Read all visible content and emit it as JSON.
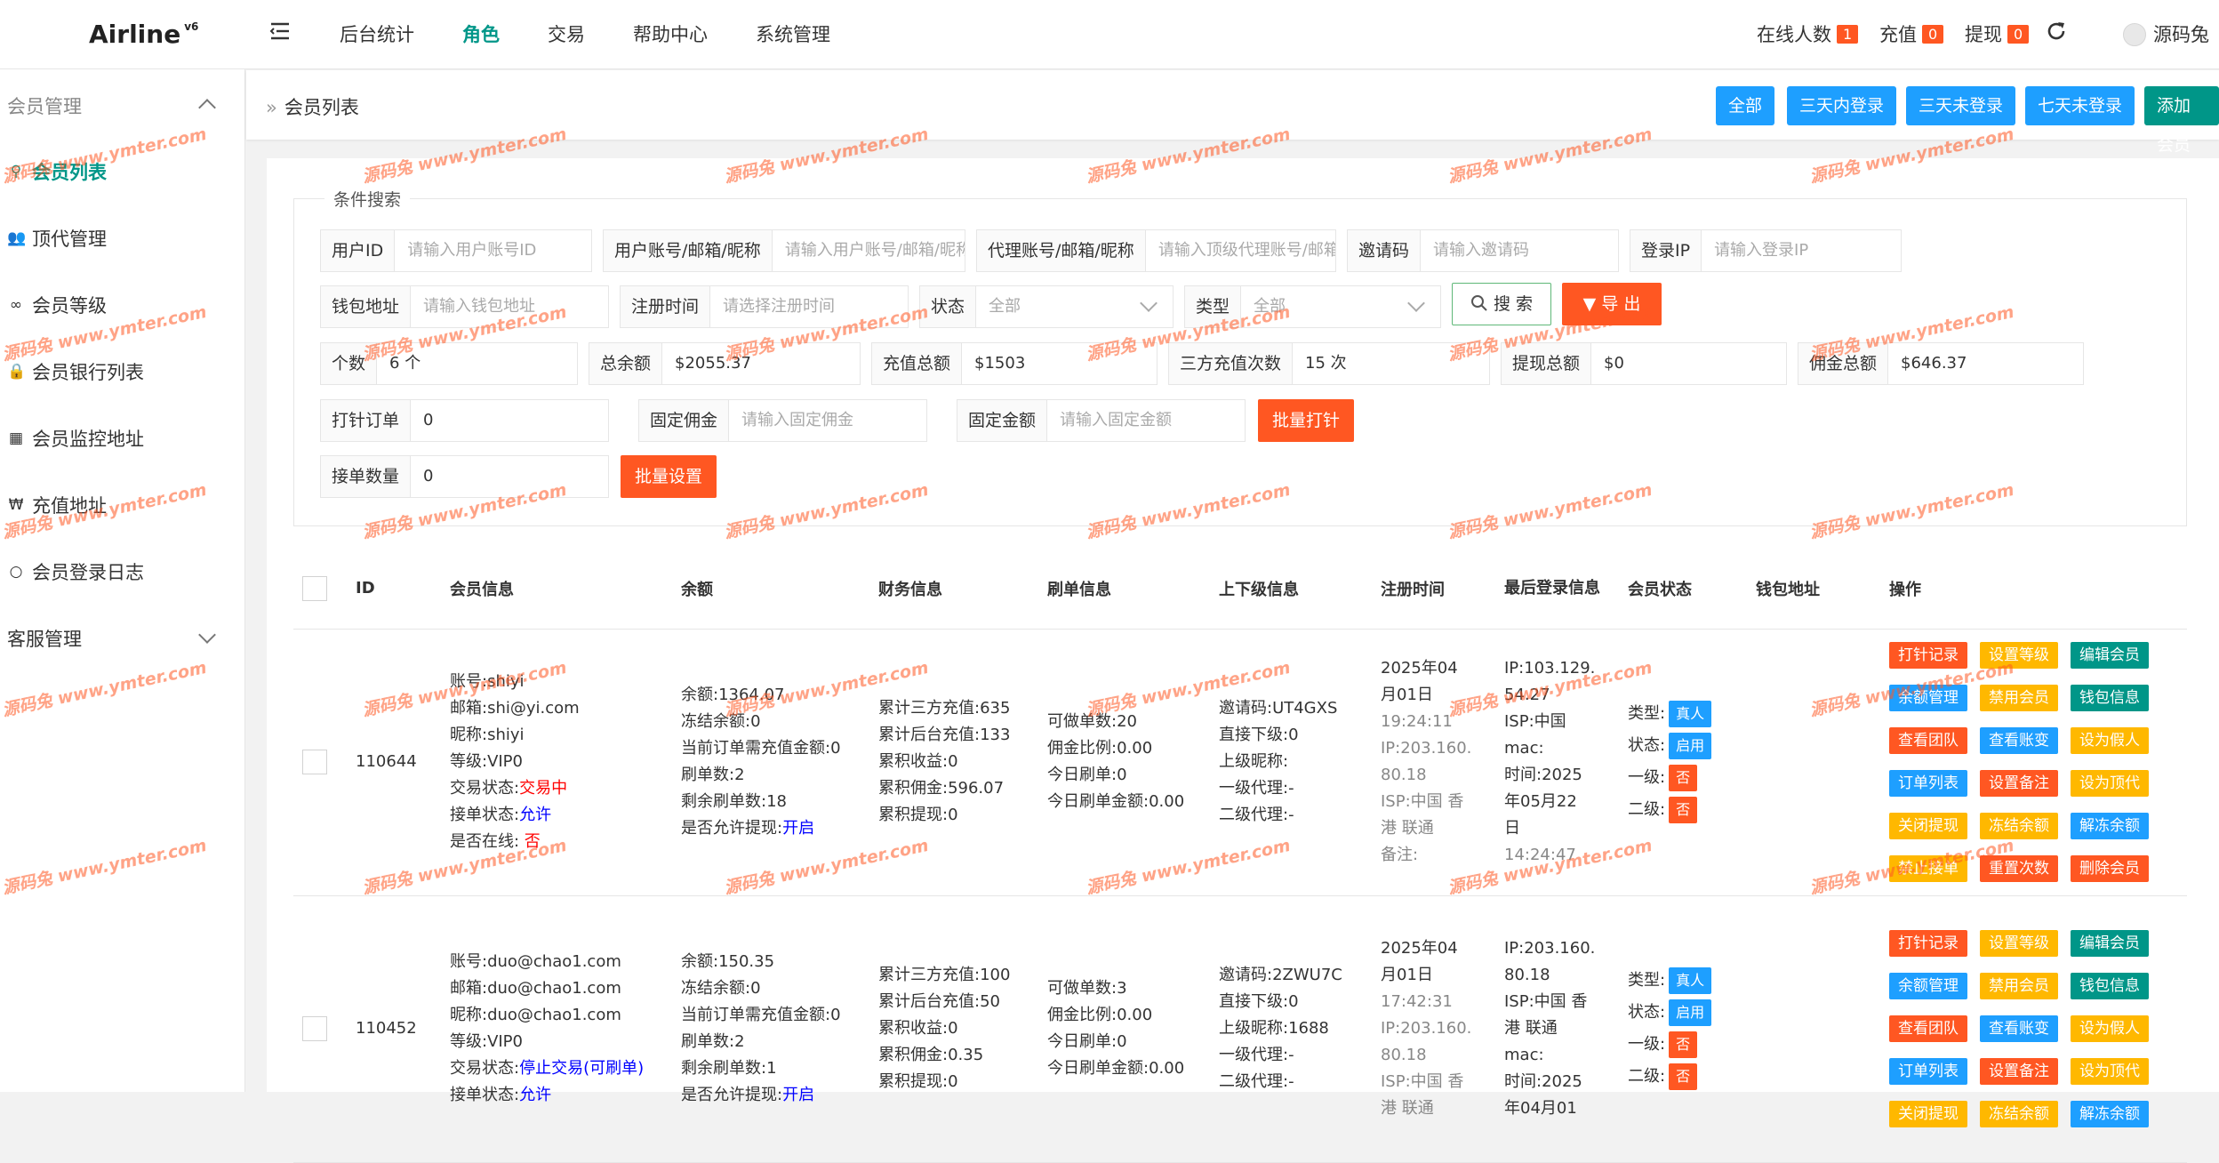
{
  "app": {
    "logo": "Airline",
    "version": "v6"
  },
  "nav": [
    {
      "label": "后台统计"
    },
    {
      "label": "角色"
    },
    {
      "label": "交易"
    },
    {
      "label": "帮助中心"
    },
    {
      "label": "系统管理"
    }
  ],
  "header_stats": {
    "online_label": "在线人数",
    "online_value": "1",
    "recharge_label": "充值",
    "recharge_value": "0",
    "withdraw_label": "提现",
    "withdraw_value": "0",
    "username": "源码兔"
  },
  "sidebar": {
    "group1": "会员管理",
    "items": [
      {
        "label": "会员列表",
        "icon": "user-icon"
      },
      {
        "label": "顶代管理",
        "icon": "users-icon"
      },
      {
        "label": "会员等级",
        "icon": "link-icon"
      },
      {
        "label": "会员银行列表",
        "icon": "lock-icon"
      },
      {
        "label": "会员监控地址",
        "icon": "id-card-icon"
      },
      {
        "label": "充值地址",
        "icon": "won-icon"
      },
      {
        "label": "会员登录日志",
        "icon": "circle-icon"
      }
    ],
    "group2": "客服管理"
  },
  "breadcrumb": "会员列表",
  "filters": [
    "全部",
    "三天内登录",
    "三天未登录",
    "七天未登录",
    "添加会员"
  ],
  "search": {
    "legend": "条件搜索",
    "user_id": {
      "label": "用户ID",
      "placeholder": "请输入用户账号ID"
    },
    "account": {
      "label": "用户账号/邮箱/昵称",
      "placeholder": "请输入用户账号/邮箱/昵称"
    },
    "agent": {
      "label": "代理账号/邮箱/昵称",
      "placeholder": "请输入顶级代理账号/邮箱"
    },
    "invite": {
      "label": "邀请码",
      "placeholder": "请输入邀请码"
    },
    "login_ip": {
      "label": "登录IP",
      "placeholder": "请输入登录IP"
    },
    "wallet": {
      "label": "钱包地址",
      "placeholder": "请输入钱包地址"
    },
    "reg_time": {
      "label": "注册时间",
      "placeholder": "请选择注册时间"
    },
    "status": {
      "label": "状态",
      "value": "全部"
    },
    "type": {
      "label": "类型",
      "value": "全部"
    },
    "search_btn": "搜 索",
    "export_btn": "导 出"
  },
  "stats": {
    "count": {
      "label": "个数",
      "value": "6 个"
    },
    "balance": {
      "label": "总余额",
      "value": "$2055.37"
    },
    "recharge": {
      "label": "充值总额",
      "value": "$1503"
    },
    "third_times": {
      "label": "三方充值次数",
      "value": "15 次"
    },
    "withdraw": {
      "label": "提现总额",
      "value": "$0"
    },
    "commission": {
      "label": "佣金总额",
      "value": "$646.37"
    }
  },
  "batch": {
    "order": {
      "label": "打针订单",
      "value": "0"
    },
    "fixed_comm": {
      "label": "固定佣金",
      "placeholder": "请输入固定佣金"
    },
    "fixed_amount": {
      "label": "固定金额",
      "placeholder": "请输入固定金额"
    },
    "batch_btn": "批量打针",
    "orders": {
      "label": "接单数量",
      "value": "0"
    },
    "set_btn": "批量设置"
  },
  "table": {
    "headers": [
      "ID",
      "会员信息",
      "余额",
      "财务信息",
      "刷单信息",
      "上下级信息",
      "注册时间",
      "最后登录信息",
      "会员状态",
      "钱包地址",
      "操作"
    ],
    "rows": [
      {
        "id": "110644",
        "member": [
          "账号:shiyi",
          "邮箱:shi@yi.com",
          "昵称:shiyi",
          "等级:VIP0"
        ],
        "trade_label": "交易状态:",
        "trade_value": "交易中",
        "accept_label": "接单状态:",
        "accept_value": "允许",
        "online_label": "是否在线: ",
        "online_value": "否",
        "balance": [
          "余额:1364.07",
          "冻结余额:0",
          "当前订单需充值金额:0",
          "刷单数:2",
          "剩余刷单数:18"
        ],
        "withdraw_label": "是否允许提现:",
        "withdraw_value": "开启",
        "finance": [
          "累计三方充值:635",
          "累计后台充值:133",
          "累积收益:0",
          "累积佣金:596.07",
          "累积提现:0"
        ],
        "brush": [
          "可做单数:20",
          "佣金比例:0.00",
          "今日刷单:0",
          "今日刷单金额:0.00"
        ],
        "relation": [
          "邀请码:UT4GXS",
          "直接下级:0",
          "上级昵称:",
          "一级代理:-",
          "二级代理:-"
        ],
        "reg": [
          "2025年04",
          "月01日"
        ],
        "reg_grey": [
          "19:24:11",
          "IP:203.160.",
          "80.18",
          "ISP:中国 香",
          "港 联通",
          "备注:"
        ],
        "last": [
          "IP:103.129.",
          "54.27",
          "ISP:中国",
          "mac:",
          "时间:2025",
          "年05月22",
          "日"
        ],
        "last_grey": [
          "14:24:47"
        ],
        "status": {
          "type_label": "类型:",
          "type": "真人",
          "state_label": "状态:",
          "state": "启用",
          "l1_label": "一级:",
          "l1": "否",
          "l2_label": "二级:",
          "l2": "否"
        }
      },
      {
        "id": "110452",
        "member": [
          "账号:duo@chao1.com",
          "邮箱:duo@chao1.com",
          "昵称:duo@chao1.com",
          "等级:VIP0"
        ],
        "trade_label": "交易状态:",
        "trade_value": "停止交易(可刷单)",
        "accept_label": "接单状态:",
        "accept_value": "允许",
        "balance": [
          "余额:150.35",
          "冻结余额:0",
          "当前订单需充值金额:0",
          "刷单数:2",
          "剩余刷单数:1"
        ],
        "withdraw_label": "是否允许提现:",
        "withdraw_value": "开启",
        "finance": [
          "累计三方充值:100",
          "累计后台充值:50",
          "累积收益:0",
          "累积佣金:0.35",
          "累积提现:0"
        ],
        "brush": [
          "可做单数:3",
          "佣金比例:0.00",
          "今日刷单:0",
          "今日刷单金额:0.00"
        ],
        "relation": [
          "邀请码:2ZWU7C",
          "直接下级:0",
          "上级昵称:1688",
          "一级代理:-",
          "二级代理:-"
        ],
        "reg": [
          "2025年04",
          "月01日"
        ],
        "reg_grey": [
          "17:42:31",
          "IP:203.160.",
          "80.18",
          "ISP:中国 香",
          "港 联通"
        ],
        "last": [
          "IP:203.160.",
          "80.18",
          "ISP:中国 香",
          "港 联通",
          "mac:",
          "时间:2025",
          "年04月01"
        ],
        "status": {
          "type_label": "类型:",
          "type": "真人",
          "state_label": "状态:",
          "state": "启用",
          "l1_label": "一级:",
          "l1": "否",
          "l2_label": "二级:",
          "l2": "否"
        }
      }
    ],
    "ops": [
      {
        "label": "打针记录",
        "color": "red"
      },
      {
        "label": "设置等级",
        "color": "orange"
      },
      {
        "label": "编辑会员",
        "color": "green"
      },
      {
        "label": "余额管理",
        "color": "blue"
      },
      {
        "label": "禁用会员",
        "color": "orange"
      },
      {
        "label": "钱包信息",
        "color": "green"
      },
      {
        "label": "查看团队",
        "color": "red"
      },
      {
        "label": "查看账变",
        "color": "blue"
      },
      {
        "label": "设为假人",
        "color": "orange"
      },
      {
        "label": "订单列表",
        "color": "blue"
      },
      {
        "label": "设置备注",
        "color": "red"
      },
      {
        "label": "设为顶代",
        "color": "orange"
      },
      {
        "label": "关闭提现",
        "color": "orange"
      },
      {
        "label": "冻结余额",
        "color": "orange"
      },
      {
        "label": "解冻余额",
        "color": "blue"
      },
      {
        "label": "禁止接单",
        "color": "orange"
      },
      {
        "label": "重置次数",
        "color": "red"
      },
      {
        "label": "删除会员",
        "color": "red"
      }
    ]
  },
  "watermark": "源码兔 www.ymter.com"
}
